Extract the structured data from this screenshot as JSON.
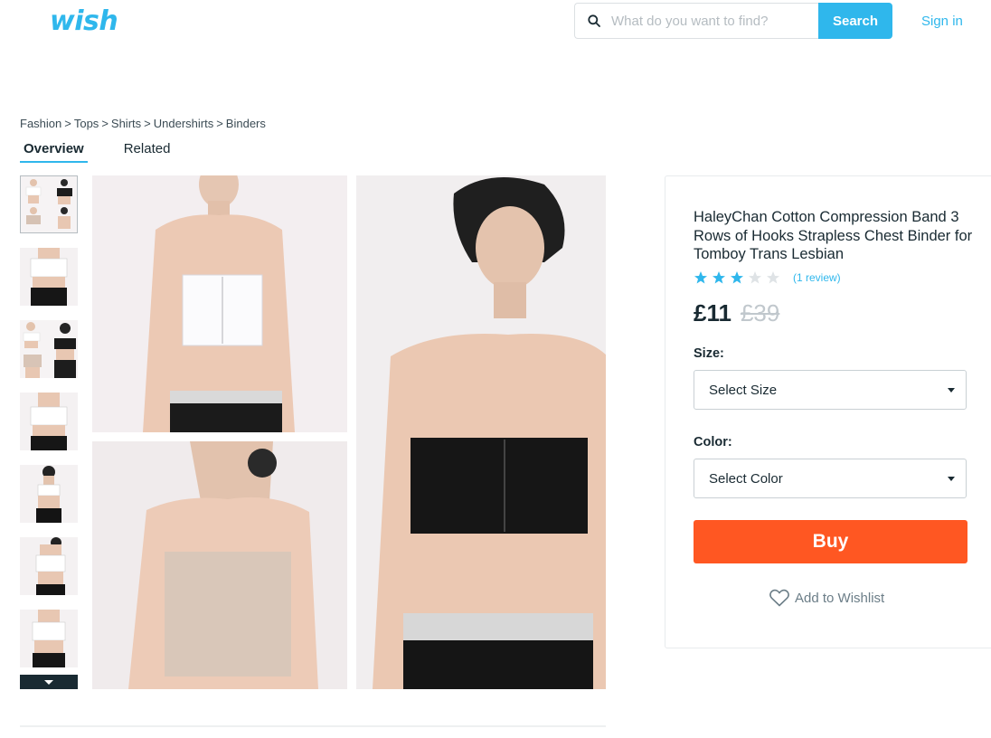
{
  "header": {
    "logo": "wish",
    "search_placeholder": "What do you want to find?",
    "search_button": "Search",
    "sign_in": "Sign in"
  },
  "breadcrumb": [
    "Fashion",
    "Tops",
    "Shirts",
    "Undershirts",
    "Binders"
  ],
  "breadcrumb_separator": ">",
  "tabs": [
    {
      "label": "Overview",
      "active": true
    },
    {
      "label": "Related",
      "active": false
    }
  ],
  "product": {
    "title": "HaleyChan Cotton Compression Band 3 Rows of Hooks Strapless Chest Binder for Tomboy Trans Lesbian",
    "rating": 3,
    "rating_max": 5,
    "review_text": "(1 review)",
    "price": "£11",
    "original_price": "£39",
    "size_label": "Size:",
    "size_select": "Select Size",
    "color_label": "Color:",
    "color_select": "Select Color",
    "buy_label": "Buy",
    "wishlist_label": "Add to Wishlist"
  },
  "colors": {
    "brand": "#2fb7ec",
    "buy": "#ff5722",
    "star_filled": "#2fb7ec",
    "star_empty": "#dfe3e6"
  },
  "icons": [
    "search-icon",
    "star-icon",
    "chevron-down-icon",
    "heart-icon"
  ]
}
